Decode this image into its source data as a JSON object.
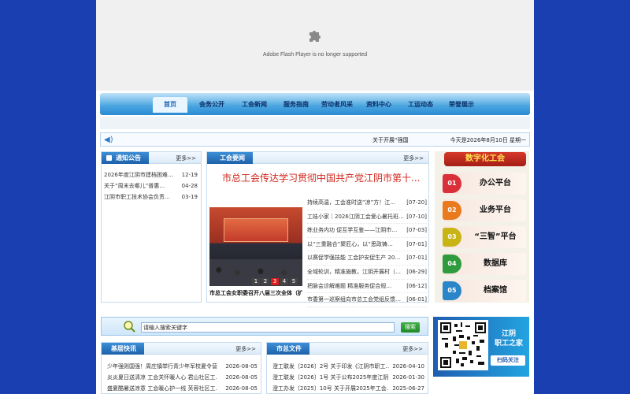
{
  "flash": {
    "message": "Adobe Flash Player is no longer supported",
    "icon": "puzzle-icon"
  },
  "nav": [
    {
      "label": "首页",
      "active": true
    },
    {
      "label": "会务公开"
    },
    {
      "label": "工会新闻"
    },
    {
      "label": "服务指南"
    },
    {
      "label": "劳动者风采"
    },
    {
      "label": "资料中心"
    },
    {
      "label": "工运动态"
    },
    {
      "label": "荣誉展示"
    }
  ],
  "ticker": {
    "scroll_text": "关于开展“强国",
    "date_text": "今天是2026年8月10日 星期一"
  },
  "notice": {
    "title": "通知公告",
    "more": "更多>>",
    "items": [
      {
        "title": "2026年度江阴市建档困难…",
        "date": "12-19"
      },
      {
        "title": "关于“周末去哪儿”普惠…",
        "date": "04-28"
      },
      {
        "title": "江阴市职工技术协会负责…",
        "date": "03-19"
      }
    ]
  },
  "news": {
    "title": "工会要闻",
    "more": "更多>>",
    "headline": "市总工会传达学习贯彻中国共产党江阴市第十...",
    "photo_caption": "市总工会女职委召开八届三次全体（扩大）会议",
    "pager": [
      "1",
      "2",
      "3",
      "4",
      "5"
    ],
    "pager_active": 3,
    "items": [
      {
        "title": "持续高温，工会准时送“凉”方！江…",
        "date": "[07-20]"
      },
      {
        "title": "工娃小家｜2026江阴工会爱心暑托班…",
        "date": "[07-10]"
      },
      {
        "title": "练业务内功 促互学互鉴——江阴市…",
        "date": "[07-03]"
      },
      {
        "title": "以“三重融合”聚匠心，以“思政铸…",
        "date": "[07-01]"
      },
      {
        "title": "以赛促学强技能 工会护安促生产 20…",
        "date": "[07-01]"
      },
      {
        "title": "全域轮训，精准施教，江阴开展村（…",
        "date": "[06-29]"
      },
      {
        "title": "把脉会诊解难题 精准服务促合规…",
        "date": "[06-12]"
      },
      {
        "title": "市委第一巡察组向市总工会党组反馈…",
        "date": "[06-01]"
      }
    ]
  },
  "digital": {
    "title": "数字化工会",
    "items": [
      {
        "num": "01",
        "label": "办公平台",
        "color": "#d9303a"
      },
      {
        "num": "02",
        "label": "业务平台",
        "color": "#ea7a1e"
      },
      {
        "num": "03",
        "label": "“三智”平台",
        "color": "#c8b414"
      },
      {
        "num": "04",
        "label": "数据库",
        "color": "#2e9b3c"
      },
      {
        "num": "05",
        "label": "档案馆",
        "color": "#2a86c8"
      }
    ]
  },
  "search": {
    "placeholder": "请输入搜索关键字",
    "value": "请输入搜索关键字",
    "button": "搜索"
  },
  "grassroots": {
    "title": "基层快讯",
    "more": "更多>>",
    "items": [
      {
        "title": "少年强则国强！周庄镇举行青少年军校夏令营…",
        "date": "2026-08-05"
      },
      {
        "title": "炎炎夏日送清凉 工会关怀暖人心 君山社区工…",
        "date": "2026-08-05"
      },
      {
        "title": "盛夏酷暑送凉意 工会暖心护一线 芙蓉社区工…",
        "date": "2026-08-05"
      }
    ]
  },
  "files": {
    "title": "市总文件",
    "more": "更多>>",
    "items": [
      {
        "title": "澄工联发〔2026〕2号 关于印发《江阴市职工…",
        "date": "2026-04-10"
      },
      {
        "title": "澄工联发〔2026〕1号 关于公布2025年度江阴…",
        "date": "2026-01-30"
      },
      {
        "title": "澄工办发〔2025〕10号 关于开展2025年工会…",
        "date": "2025-06-27"
      }
    ]
  },
  "qr": {
    "line1": "江阴",
    "line2": "职工之家",
    "scan": "扫码关注"
  },
  "colors": {
    "background": "#1a3fb0",
    "accent": "#1d61aa",
    "headline": "#d0261b"
  }
}
